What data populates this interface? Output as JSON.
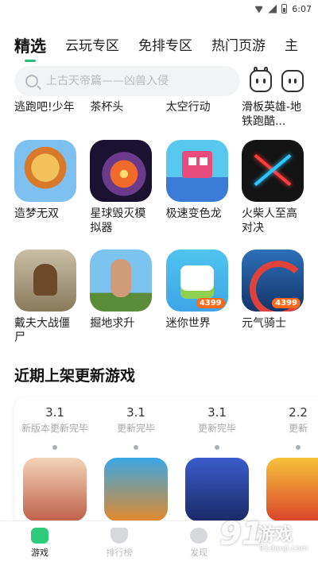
{
  "status_bar": {
    "time": "6:07"
  },
  "tabs": [
    {
      "label": "精选",
      "active": true
    },
    {
      "label": "云玩专区",
      "active": false
    },
    {
      "label": "免排专区",
      "active": false
    },
    {
      "label": "热门页游",
      "active": false
    },
    {
      "label": "主",
      "active": false
    }
  ],
  "search": {
    "placeholder": "上古天帝篇——凶兽入侵"
  },
  "header_icons": {
    "left": "cat-face-icon",
    "right": "message-face-icon"
  },
  "games_row_1": [
    {
      "name": "逃跑吧!少年"
    },
    {
      "name": "茶杯头"
    },
    {
      "name": "太空行动"
    },
    {
      "name": "滑板英雄-地铁跑酷..."
    }
  ],
  "games_row_2": [
    {
      "name": "造梦无双"
    },
    {
      "name": "星球毁灭模拟器"
    },
    {
      "name": "极速变色龙"
    },
    {
      "name": "火柴人至高对决"
    }
  ],
  "games_row_3": [
    {
      "name": "戴夫大战僵尸"
    },
    {
      "name": "掘地求升"
    },
    {
      "name": "迷你世界",
      "badge": "4399"
    },
    {
      "name": "元气骑士",
      "badge": "4399"
    }
  ],
  "recent_updates": {
    "title": "近期上架更新游戏",
    "items": [
      {
        "version": "3.1",
        "status": "新版本更新完毕"
      },
      {
        "version": "3.1",
        "status": "更新完毕"
      },
      {
        "version": "3.1",
        "status": "更新完毕"
      },
      {
        "version": "2.2",
        "status": "更新"
      }
    ]
  },
  "bottom_nav": [
    {
      "label": "游戏",
      "icon": "gamepad-icon",
      "active": true
    },
    {
      "label": "排行榜",
      "icon": "shield-icon",
      "active": false
    },
    {
      "label": "发现",
      "icon": "eye-icon",
      "active": false
    }
  ],
  "watermark": {
    "text": "91游戏",
    "url": "91danji.com"
  },
  "colors": {
    "accent": "#27c178"
  }
}
